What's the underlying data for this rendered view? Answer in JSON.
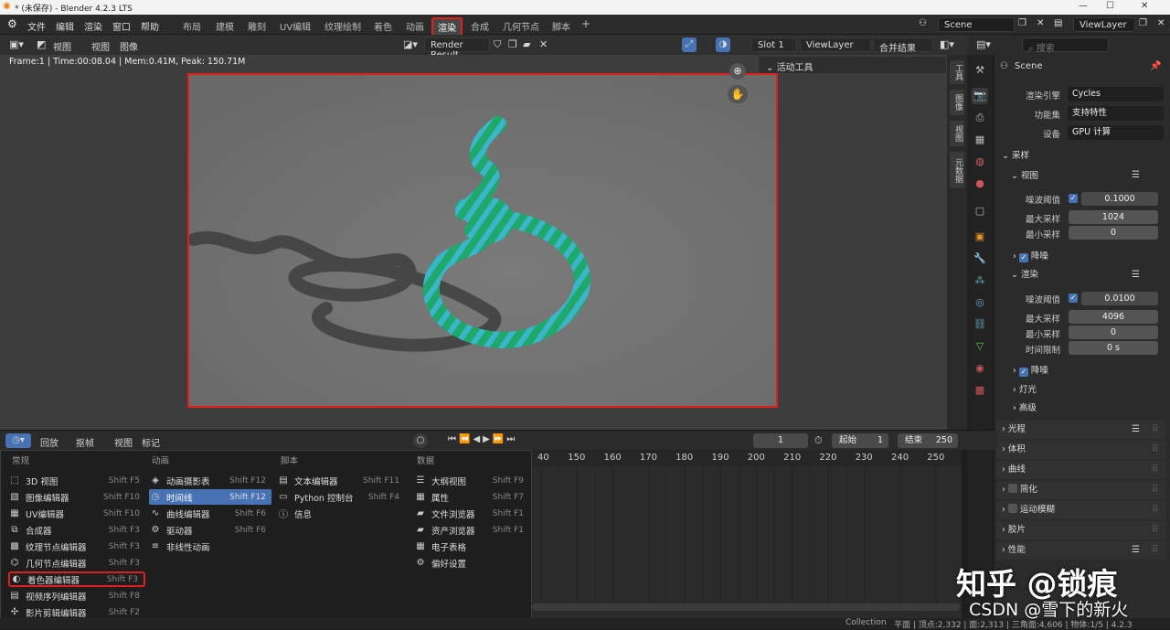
{
  "window": {
    "title": "* (未保存) - Blender 4.2.3 LTS"
  },
  "menus": [
    "文件",
    "编辑",
    "渲染",
    "窗口",
    "帮助"
  ],
  "workspace_tabs": [
    "布局",
    "建模",
    "雕刻",
    "UV编辑",
    "纹理绘制",
    "着色",
    "动画",
    "渲染",
    "合成",
    "几何节点",
    "脚本"
  ],
  "active_tab": "渲染",
  "scene": {
    "name": "Scene",
    "view_layer": "ViewLayer"
  },
  "image_editor": {
    "view_menu": "视图",
    "menus": [
      "视图",
      "图像"
    ],
    "image_name": "Render Result",
    "slot": "Slot 1",
    "view_layer": "ViewLayer",
    "pass": "合并结果",
    "frame_info": "Frame:1 | Time:00:08.04 | Mem:0.41M, Peak: 150.71M",
    "active_tool": "活动工具",
    "side_tabs": [
      "工具",
      "图像",
      "视图",
      "元数据"
    ]
  },
  "timeline": {
    "menus": [
      "回放",
      "抠帧",
      "视图",
      "标记"
    ],
    "current_frame": "1",
    "start_label": "起始",
    "start": "1",
    "end_label": "结束",
    "end": "250",
    "ticks": [
      "40",
      "150",
      "160",
      "170",
      "180",
      "190",
      "200",
      "210",
      "220",
      "230",
      "240",
      "250"
    ]
  },
  "editor_menu": {
    "columns": [
      {
        "header": "常规",
        "items": [
          {
            "label": "3D 视图",
            "shortcut": "Shift F5",
            "icon": "3d-view-icon"
          },
          {
            "label": "图像编辑器",
            "shortcut": "Shift F10",
            "icon": "image-editor-icon"
          },
          {
            "label": "UV编辑器",
            "shortcut": "Shift F10",
            "icon": "uv-editor-icon"
          },
          {
            "label": "合成器",
            "shortcut": "Shift F3",
            "icon": "compositor-icon"
          },
          {
            "label": "纹理节点编辑器",
            "shortcut": "Shift F3",
            "icon": "texture-node-icon"
          },
          {
            "label": "几何节点编辑器",
            "shortcut": "Shift F3",
            "icon": "geometry-node-icon"
          },
          {
            "label": "着色器编辑器",
            "shortcut": "Shift F3",
            "icon": "shader-editor-icon"
          },
          {
            "label": "视频序列编辑器",
            "shortcut": "Shift F8",
            "icon": "sequencer-icon"
          },
          {
            "label": "影片剪辑编辑器",
            "shortcut": "Shift F2",
            "icon": "clip-editor-icon"
          }
        ]
      },
      {
        "header": "动画",
        "items": [
          {
            "label": "动画摄影表",
            "shortcut": "Shift F12",
            "icon": "dopesheet-icon"
          },
          {
            "label": "时间线",
            "shortcut": "Shift F12",
            "icon": "timeline-icon"
          },
          {
            "label": "曲线编辑器",
            "shortcut": "Shift F6",
            "icon": "graph-editor-icon"
          },
          {
            "label": "驱动器",
            "shortcut": "Shift F6",
            "icon": "drivers-icon"
          },
          {
            "label": "非线性动画",
            "shortcut": "",
            "icon": "nla-icon"
          }
        ]
      },
      {
        "header": "脚本",
        "items": [
          {
            "label": "文本编辑器",
            "shortcut": "Shift F11",
            "icon": "text-editor-icon"
          },
          {
            "label": "Python 控制台",
            "shortcut": "Shift F4",
            "icon": "console-icon"
          },
          {
            "label": "信息",
            "shortcut": "",
            "icon": "info-icon"
          }
        ]
      },
      {
        "header": "数据",
        "items": [
          {
            "label": "大纲视图",
            "shortcut": "Shift F9",
            "icon": "outliner-icon"
          },
          {
            "label": "属性",
            "shortcut": "Shift F7",
            "icon": "properties-icon"
          },
          {
            "label": "文件浏览器",
            "shortcut": "Shift F1",
            "icon": "file-browser-icon"
          },
          {
            "label": "资产浏览器",
            "shortcut": "Shift F1",
            "icon": "asset-browser-icon"
          },
          {
            "label": "电子表格",
            "shortcut": "",
            "icon": "spreadsheet-icon"
          },
          {
            "label": "偏好设置",
            "shortcut": "",
            "icon": "preferences-icon"
          }
        ]
      }
    ]
  },
  "properties": {
    "search_placeholder": "搜索",
    "scene": "Scene",
    "render_engine_label": "渲染引擎",
    "render_engine": "Cycles",
    "feature_set_label": "功能集",
    "feature_set": "支持特性",
    "device_label": "设备",
    "device": "GPU 计算",
    "sampling": "采样",
    "viewport": "视图",
    "render": "渲染",
    "noise_threshold_label": "噪波阈值",
    "max_samples_label": "最大采样",
    "min_samples_label": "最小采样",
    "time_limit_label": "时间限制",
    "viewport_noise_threshold": "0.1000",
    "viewport_max_samples": "1024",
    "viewport_min_samples": "0",
    "render_noise_threshold": "0.0100",
    "render_max_samples": "4096",
    "render_min_samples": "0",
    "render_time_limit": "0 s",
    "denoise": "降噪",
    "lights": "灯光",
    "advanced": "高级",
    "light_paths": "光程",
    "volumes": "体积",
    "curves": "曲线",
    "simplify": "简化",
    "motion_blur": "运动模糊",
    "film": "胶片",
    "performance": "性能"
  },
  "status": {
    "collection": "Collection",
    "stats": "平面 | 顶点:2,332 | 面:2,313 | 三角面:4,606 | 物体:1/5 | 4.2.3"
  },
  "watermark": {
    "line1": "知乎 @锁痕",
    "line2": "CSDN @雪下的新火"
  },
  "colors": {
    "accent": "#4772b3",
    "highlight": "#e02020",
    "render_bg": "#717171"
  }
}
